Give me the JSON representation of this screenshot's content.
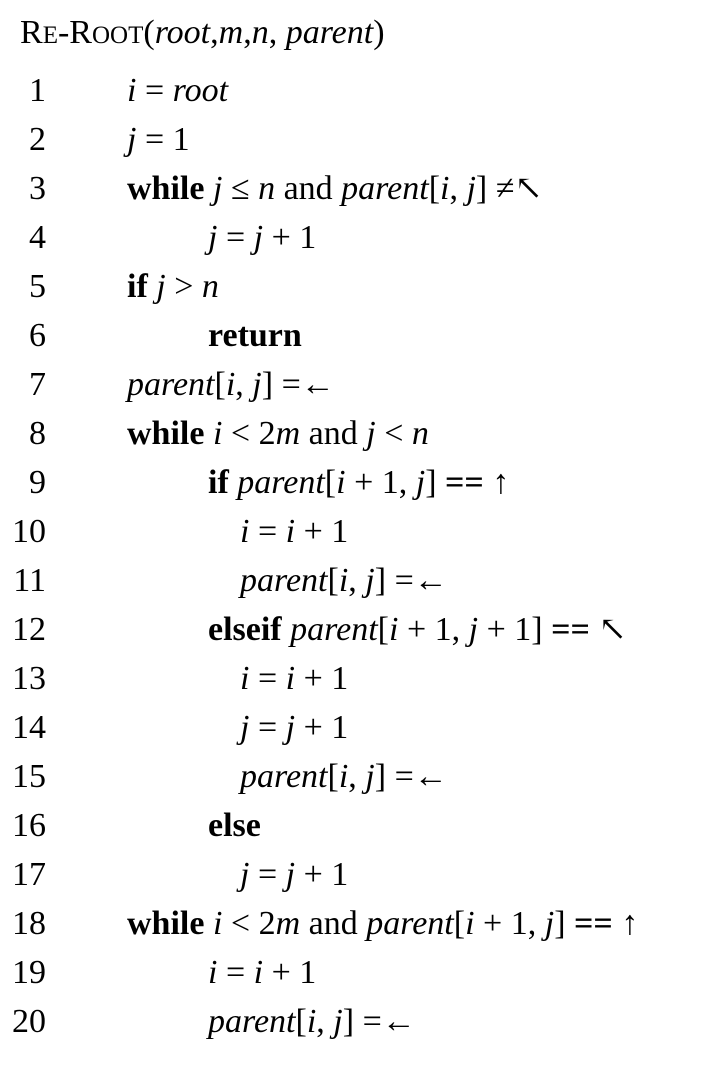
{
  "title": {
    "r": "R",
    "e": "E",
    "dash": "-",
    "r2": "R",
    "oot": "OOT",
    "open": "(",
    "p1": "root",
    "c1": ",",
    "p2": "m",
    "c2": ",",
    "p3": "n",
    "c3": ", ",
    "p4": "parent",
    "close": ")"
  },
  "lines": [
    {
      "num": "1",
      "indent": 0,
      "parts": [
        {
          "t": "i",
          "s": "var"
        },
        {
          "t": " = ",
          "s": "op"
        },
        {
          "t": "root",
          "s": "var"
        }
      ]
    },
    {
      "num": "2",
      "indent": 0,
      "parts": [
        {
          "t": "j",
          "s": "var"
        },
        {
          "t": " = 1",
          "s": "op"
        }
      ]
    },
    {
      "num": "3",
      "indent": 0,
      "parts": [
        {
          "t": "while",
          "s": "kw"
        },
        {
          "t": " ",
          "s": "op"
        },
        {
          "t": "j",
          "s": "var"
        },
        {
          "t": " ≤ ",
          "s": "op"
        },
        {
          "t": "n",
          "s": "var"
        },
        {
          "t": " and ",
          "s": "op"
        },
        {
          "t": "parent",
          "s": "var"
        },
        {
          "t": "[",
          "s": "op"
        },
        {
          "t": "i",
          "s": "var"
        },
        {
          "t": ", ",
          "s": "op"
        },
        {
          "t": "j",
          "s": "var"
        },
        {
          "t": "] ≠↖",
          "s": "op"
        }
      ]
    },
    {
      "num": "4",
      "indent": 1,
      "parts": [
        {
          "t": "j",
          "s": "var"
        },
        {
          "t": " = ",
          "s": "op"
        },
        {
          "t": "j",
          "s": "var"
        },
        {
          "t": " + 1",
          "s": "op"
        }
      ]
    },
    {
      "num": "5",
      "indent": 0,
      "parts": [
        {
          "t": "if",
          "s": "kw"
        },
        {
          "t": " ",
          "s": "op"
        },
        {
          "t": "j",
          "s": "var"
        },
        {
          "t": " > ",
          "s": "op"
        },
        {
          "t": "n",
          "s": "var"
        }
      ]
    },
    {
      "num": "6",
      "indent": 1,
      "parts": [
        {
          "t": "return",
          "s": "kw"
        }
      ]
    },
    {
      "num": "7",
      "indent": 0,
      "parts": [
        {
          "t": "parent",
          "s": "var"
        },
        {
          "t": "[",
          "s": "op"
        },
        {
          "t": "i",
          "s": "var"
        },
        {
          "t": ", ",
          "s": "op"
        },
        {
          "t": "j",
          "s": "var"
        },
        {
          "t": "] =←",
          "s": "op"
        }
      ]
    },
    {
      "num": "8",
      "indent": 0,
      "parts": [
        {
          "t": "while",
          "s": "kw"
        },
        {
          "t": " ",
          "s": "op"
        },
        {
          "t": "i",
          "s": "var"
        },
        {
          "t": " < 2",
          "s": "op"
        },
        {
          "t": "m",
          "s": "var"
        },
        {
          "t": " and ",
          "s": "op"
        },
        {
          "t": "j",
          "s": "var"
        },
        {
          "t": " < ",
          "s": "op"
        },
        {
          "t": "n",
          "s": "var"
        }
      ]
    },
    {
      "num": "9",
      "indent": 1,
      "parts": [
        {
          "t": "if",
          "s": "kw"
        },
        {
          "t": " ",
          "s": "op"
        },
        {
          "t": "parent",
          "s": "var"
        },
        {
          "t": "[",
          "s": "op"
        },
        {
          "t": "i",
          "s": "var"
        },
        {
          "t": " + 1, ",
          "s": "op"
        },
        {
          "t": "j",
          "s": "var"
        },
        {
          "t": "] ",
          "s": "op"
        },
        {
          "t": "==",
          "s": "kw"
        },
        {
          "t": " ↑",
          "s": "op"
        }
      ]
    },
    {
      "num": "10",
      "indent": 2,
      "parts": [
        {
          "t": "i",
          "s": "var"
        },
        {
          "t": " = ",
          "s": "op"
        },
        {
          "t": "i",
          "s": "var"
        },
        {
          "t": " + 1",
          "s": "op"
        }
      ]
    },
    {
      "num": "11",
      "indent": 2,
      "parts": [
        {
          "t": "parent",
          "s": "var"
        },
        {
          "t": "[",
          "s": "op"
        },
        {
          "t": "i",
          "s": "var"
        },
        {
          "t": ", ",
          "s": "op"
        },
        {
          "t": "j",
          "s": "var"
        },
        {
          "t": "] =←",
          "s": "op"
        }
      ]
    },
    {
      "num": "12",
      "indent": 1,
      "parts": [
        {
          "t": "elseif",
          "s": "kw"
        },
        {
          "t": " ",
          "s": "op"
        },
        {
          "t": "parent",
          "s": "var"
        },
        {
          "t": "[",
          "s": "op"
        },
        {
          "t": "i",
          "s": "var"
        },
        {
          "t": " + 1, ",
          "s": "op"
        },
        {
          "t": "j",
          "s": "var"
        },
        {
          "t": " + 1] ",
          "s": "op"
        },
        {
          "t": "==",
          "s": "kw"
        },
        {
          "t": " ↖",
          "s": "op"
        }
      ]
    },
    {
      "num": "13",
      "indent": 2,
      "parts": [
        {
          "t": "i",
          "s": "var"
        },
        {
          "t": " = ",
          "s": "op"
        },
        {
          "t": "i",
          "s": "var"
        },
        {
          "t": " + 1",
          "s": "op"
        }
      ]
    },
    {
      "num": "14",
      "indent": 2,
      "parts": [
        {
          "t": "j",
          "s": "var"
        },
        {
          "t": " = ",
          "s": "op"
        },
        {
          "t": "j",
          "s": "var"
        },
        {
          "t": " + 1",
          "s": "op"
        }
      ]
    },
    {
      "num": "15",
      "indent": 2,
      "parts": [
        {
          "t": "parent",
          "s": "var"
        },
        {
          "t": "[",
          "s": "op"
        },
        {
          "t": "i",
          "s": "var"
        },
        {
          "t": ", ",
          "s": "op"
        },
        {
          "t": "j",
          "s": "var"
        },
        {
          "t": "] =←",
          "s": "op"
        }
      ]
    },
    {
      "num": "16",
      "indent": 1,
      "parts": [
        {
          "t": "else",
          "s": "kw"
        }
      ]
    },
    {
      "num": "17",
      "indent": 2,
      "parts": [
        {
          "t": "j",
          "s": "var"
        },
        {
          "t": " = ",
          "s": "op"
        },
        {
          "t": "j",
          "s": "var"
        },
        {
          "t": " + 1",
          "s": "op"
        }
      ]
    },
    {
      "num": "18",
      "indent": 0,
      "parts": [
        {
          "t": "while",
          "s": "kw"
        },
        {
          "t": " ",
          "s": "op"
        },
        {
          "t": "i",
          "s": "var"
        },
        {
          "t": " < 2",
          "s": "op"
        },
        {
          "t": "m",
          "s": "var"
        },
        {
          "t": " and ",
          "s": "op"
        },
        {
          "t": "parent",
          "s": "var"
        },
        {
          "t": "[",
          "s": "op"
        },
        {
          "t": "i",
          "s": "var"
        },
        {
          "t": " + 1, ",
          "s": "op"
        },
        {
          "t": "j",
          "s": "var"
        },
        {
          "t": "] ",
          "s": "op"
        },
        {
          "t": "==",
          "s": "kw"
        },
        {
          "t": " ↑",
          "s": "op"
        }
      ]
    },
    {
      "num": "19",
      "indent": 1,
      "parts": [
        {
          "t": "i",
          "s": "var"
        },
        {
          "t": " = ",
          "s": "op"
        },
        {
          "t": "i",
          "s": "var"
        },
        {
          "t": " + 1",
          "s": "op"
        }
      ]
    },
    {
      "num": "20",
      "indent": 1,
      "parts": [
        {
          "t": "parent",
          "s": "var"
        },
        {
          "t": "[",
          "s": "op"
        },
        {
          "t": "i",
          "s": "var"
        },
        {
          "t": ", ",
          "s": "op"
        },
        {
          "t": "j",
          "s": "var"
        },
        {
          "t": "] =←",
          "s": "op"
        }
      ]
    }
  ]
}
